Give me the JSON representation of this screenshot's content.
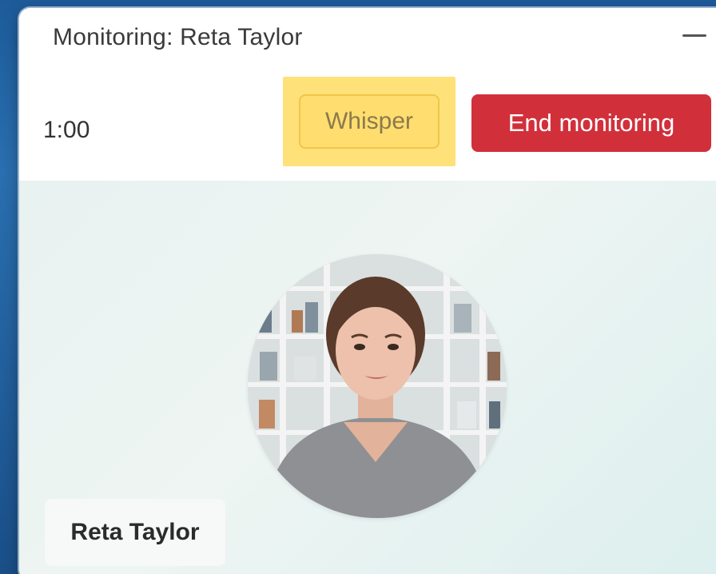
{
  "window": {
    "title": "Monitoring: Reta Taylor"
  },
  "toolbar": {
    "timer": "1:00",
    "whisper_label": "Whisper",
    "end_label": "End monitoring"
  },
  "participant": {
    "name": "Reta Taylor"
  },
  "colors": {
    "end_button": "#d1303b",
    "whisper_highlight": "#ffe17a",
    "video_background": "#e8f2f0"
  },
  "icons": {
    "minimize": "minimize-icon"
  }
}
